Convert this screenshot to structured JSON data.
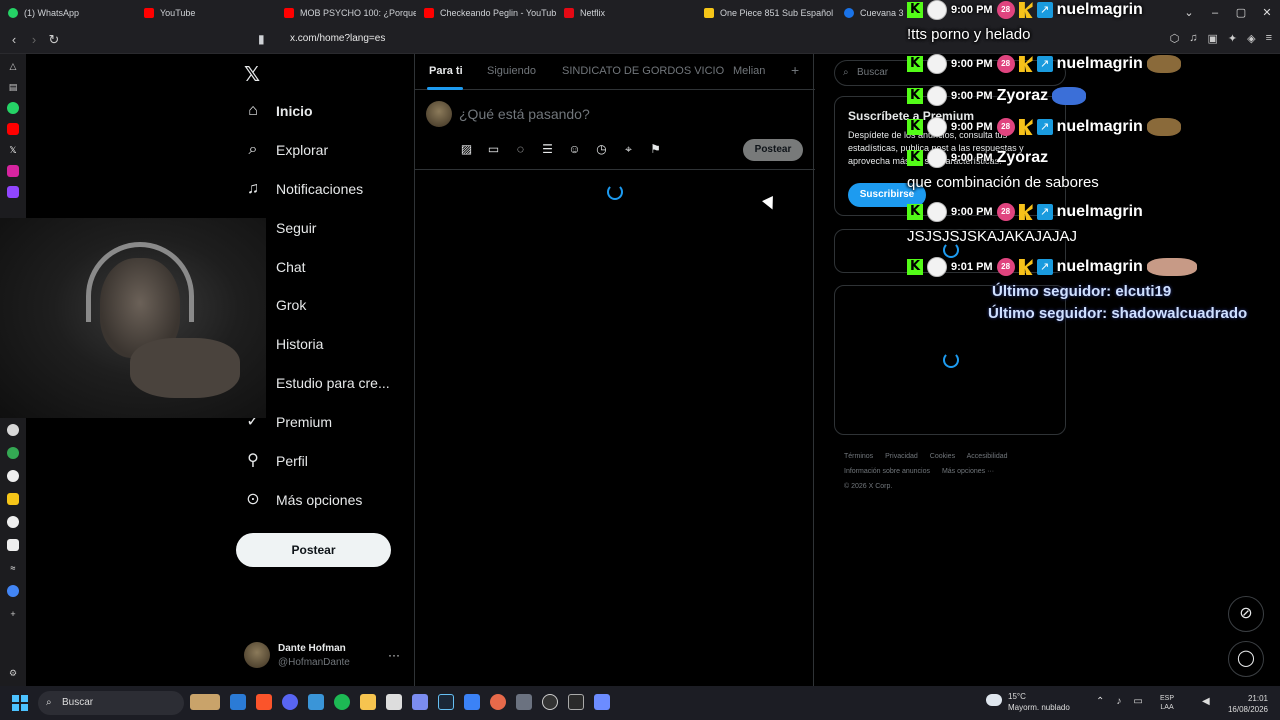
{
  "browser": {
    "tabs": [
      {
        "label": "(1) WhatsApp",
        "color": "#25d366"
      },
      {
        "label": "YouTube",
        "color": "#ff0000"
      },
      {
        "label": "MOB PSYCHO 100: ¿Porque s...",
        "color": "#ff0000"
      },
      {
        "label": "Checkeando Peglin - YouTube",
        "color": "#ff0000"
      },
      {
        "label": "Netflix",
        "color": "#e50914"
      },
      {
        "label": "One Piece 851 Sub Español O...",
        "color": "#f5c518"
      },
      {
        "label": "Cuevana 3 -",
        "color": "#1a73e8"
      }
    ],
    "url": "x.com/home?lang=es"
  },
  "sidebar": {
    "logo": "𝕏",
    "items": [
      {
        "label": "Inicio",
        "icon": "home-icon",
        "glyph": "⌂"
      },
      {
        "label": "Explorar",
        "icon": "search-icon",
        "glyph": "⌕"
      },
      {
        "label": "Notificaciones",
        "icon": "bell-icon",
        "glyph": "🔔"
      },
      {
        "label": "Seguir",
        "icon": "follow-icon",
        "glyph": ""
      },
      {
        "label": "Chat",
        "icon": "chat-icon",
        "glyph": ""
      },
      {
        "label": "Grok",
        "icon": "grok-icon",
        "glyph": ""
      },
      {
        "label": "Historia",
        "icon": "history-icon",
        "glyph": ""
      },
      {
        "label": "Estudio para cre...",
        "icon": "studio-icon",
        "glyph": ""
      },
      {
        "label": "Premium",
        "icon": "premium-icon",
        "glyph": "✓"
      },
      {
        "label": "Perfil",
        "icon": "profile-icon",
        "glyph": "👤"
      },
      {
        "label": "Más opciones",
        "icon": "more-icon",
        "glyph": "⋯"
      }
    ],
    "post_button": "Postear",
    "profile": {
      "name": "Dante Hofman",
      "handle": "@HofmanDante",
      "more": "···"
    }
  },
  "timeline": {
    "tabs": [
      "Para ti",
      "Siguiendo",
      "SINDICATO DE GORDOS VICIO",
      "Melian"
    ],
    "add_tab": "+",
    "compose_placeholder": "¿Qué está pasando?",
    "compose_tools": [
      "image-icon",
      "gif-icon",
      "grok-icon",
      "poll-icon",
      "emoji-icon",
      "schedule-icon",
      "location-icon",
      "flag-icon"
    ],
    "post_button": "Postear"
  },
  "right": {
    "search_placeholder": "Buscar",
    "premium": {
      "title": "Suscríbete a Premium",
      "description": "Despídete de los anuncios, consulta tus estadísticas, publica post a las respuestas y aprovecha más de sus características.",
      "button": "Suscribirse"
    },
    "footer": [
      "Términos",
      "Privacidad",
      "Cookies",
      "Accesibilidad",
      "Información sobre anuncios",
      "Más opciones ···",
      "© 2026 X Corp."
    ]
  },
  "chat_overlay": {
    "messages": [
      {
        "time": "9:00 PM",
        "user": "nuelmagrin",
        "text": "!tts porno y helado"
      },
      {
        "time": "9:00 PM",
        "user": "nuelmagrin",
        "text": ""
      },
      {
        "time": "9:00 PM",
        "user": "Zyoraz",
        "text": ""
      },
      {
        "time": "9:00 PM",
        "user": "nuelmagrin",
        "text": ""
      },
      {
        "time": "9:00 PM",
        "user": "Zyoraz",
        "text": "que combinación de sabores"
      },
      {
        "time": "9:00 PM",
        "user": "nuelmagrin",
        "text": "JSJSJSJSKAJAKAJAJAJ"
      },
      {
        "time": "9:01 PM",
        "user": "nuelmagrin",
        "text": ""
      }
    ],
    "badge_28": "28",
    "followers": [
      "Último seguidor: elcuti19",
      "Último seguidor: shadowalcuadrado"
    ]
  },
  "taskbar": {
    "search": "Buscar",
    "weather_temp": "15°C",
    "weather_desc": "Mayorm. nublado",
    "lang_top": "ESP",
    "lang_bottom": "LAA",
    "time": "21:01",
    "date": "16/08/2026"
  }
}
